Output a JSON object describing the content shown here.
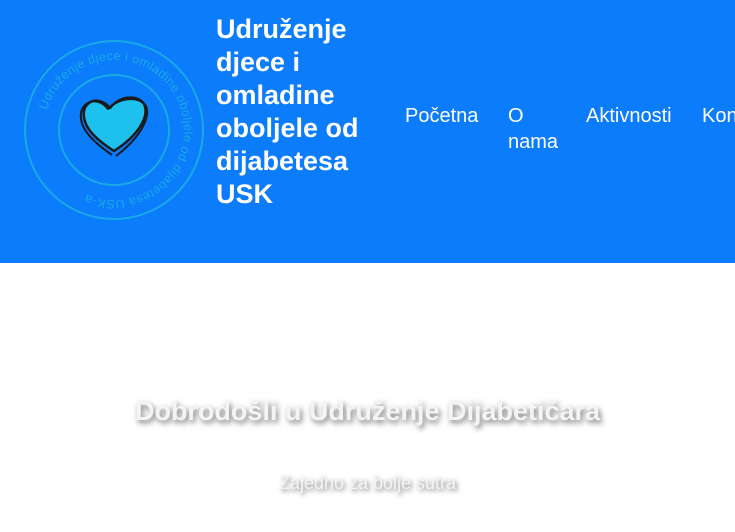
{
  "header": {
    "background_color": "#0a7cfc",
    "logo": {
      "icon": "heart-logo-icon",
      "ring_text": "Udruženje djece i omladine oboljele od dijabetesa USK-a",
      "colors": {
        "ring": "#1aa9e6",
        "heart_outline": "#1a1a1a",
        "heart_fill": "#1ec0ee"
      }
    },
    "site_title": "Udruženje djece i omladine oboljele od dijabetesa USK"
  },
  "nav": {
    "items": [
      {
        "label": "Početna"
      },
      {
        "label": "O nama"
      },
      {
        "label": "Aktivnosti"
      },
      {
        "label": "Kontakt"
      }
    ]
  },
  "hero": {
    "title": "Dobrodošli u Udruženje Dijabetičara",
    "subtitle": "Zajedno za bolje sutra"
  }
}
